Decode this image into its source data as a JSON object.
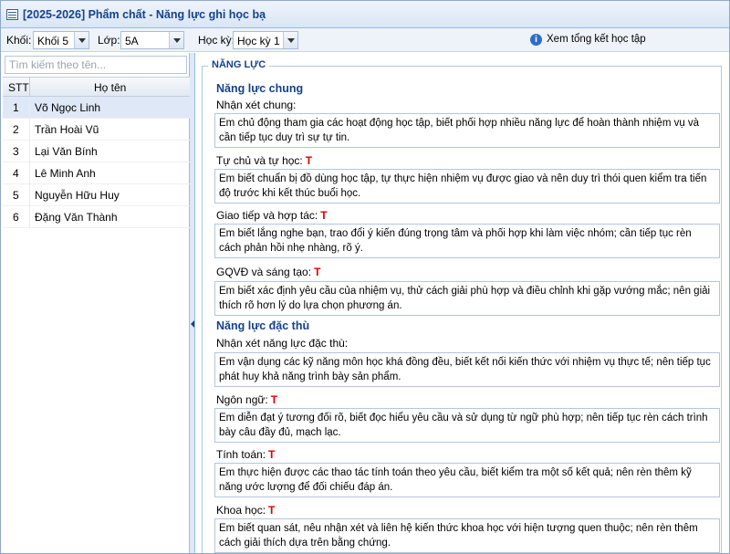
{
  "window": {
    "title": "[2025-2026] Phẩm chất - Năng lực ghi học bạ"
  },
  "toolbar": {
    "grade_label": "Khối:",
    "grade_value": "Khối 5",
    "class_label": "Lớp:",
    "class_value": "5A",
    "term_label": "Học kỳ:",
    "term_value": "Học kỳ 1",
    "summary_link": "Xem tổng kết học tập"
  },
  "search": {
    "placeholder": "Tìm kiếm theo tên..."
  },
  "grid": {
    "col_stt": "STT",
    "col_name": "Họ tên",
    "rows": [
      {
        "stt": "1",
        "name": "Võ Ngọc Linh"
      },
      {
        "stt": "2",
        "name": "Trần Hoài Vũ"
      },
      {
        "stt": "3",
        "name": "Lại Văn Bính"
      },
      {
        "stt": "4",
        "name": "Lê Minh Anh"
      },
      {
        "stt": "5",
        "name": "Nguyễn Hữu Huy"
      },
      {
        "stt": "6",
        "name": "Đặng Văn Thành"
      }
    ],
    "selected_row": 1
  },
  "panel": {
    "legend": "NĂNG LỰC",
    "general": {
      "title": "Năng lực chung",
      "comment_label": "Nhận xét chung:",
      "comment_text": "Em chủ động tham gia các hoạt động học tập, biết phối hợp nhiều năng lực để hoàn thành nhiệm vụ và cần tiếp tục duy trì sự tự tin.",
      "self_label": "Tự chủ và tự học:",
      "self_mark": "T",
      "self_text": "Em biết chuẩn bị đồ dùng học tập, tự thực hiện nhiệm vụ được giao và nên duy trì thói quen kiểm tra tiến độ trước khi kết thúc buổi học.",
      "comm_label": "Giao tiếp và hợp tác:",
      "comm_mark": "T",
      "comm_text": "Em biết lắng nghe bạn, trao đổi ý kiến đúng trọng tâm và phối hợp khi làm việc nhóm; cần tiếp tục rèn cách phản hồi nhẹ nhàng, rõ ý.",
      "solve_label": "GQVĐ và sáng tạo:",
      "solve_mark": "T",
      "solve_text": "Em biết xác định yêu cầu của nhiệm vụ, thử cách giải phù hợp và điều chỉnh khi gặp vướng mắc; nên giải thích rõ hơn lý do lựa chọn phương án."
    },
    "specific": {
      "title": "Năng lực đặc thù",
      "comment_label": "Nhận xét năng lực đặc thù:",
      "comment_text": "Em vận dụng các kỹ năng môn học khá đồng đều, biết kết nối kiến thức với nhiệm vụ thực tế; nên tiếp tục phát huy khả năng trình bày sản phẩm.",
      "lang_label": "Ngôn ngữ:",
      "lang_mark": "T",
      "lang_text": "Em diễn đạt ý tương đối rõ, biết đọc hiểu yêu cầu và sử dụng từ ngữ phù hợp; nên tiếp tục rèn cách trình bày câu đầy đủ, mạch lạc.",
      "math_label": "Tính toán:",
      "math_mark": "T",
      "math_text": "Em thực hiện được các thao tác tính toán theo yêu cầu, biết kiểm tra một số kết quả; nên rèn thêm kỹ năng ước lượng để đối chiếu đáp án.",
      "sci_label": "Khoa học:",
      "sci_mark": "T",
      "sci_text": "Em biết quan sát, nêu nhận xét và liên hệ kiến thức khoa học với hiện tượng quen thuộc; nên rèn thêm cách giải thích dựa trên bằng chứng."
    }
  }
}
